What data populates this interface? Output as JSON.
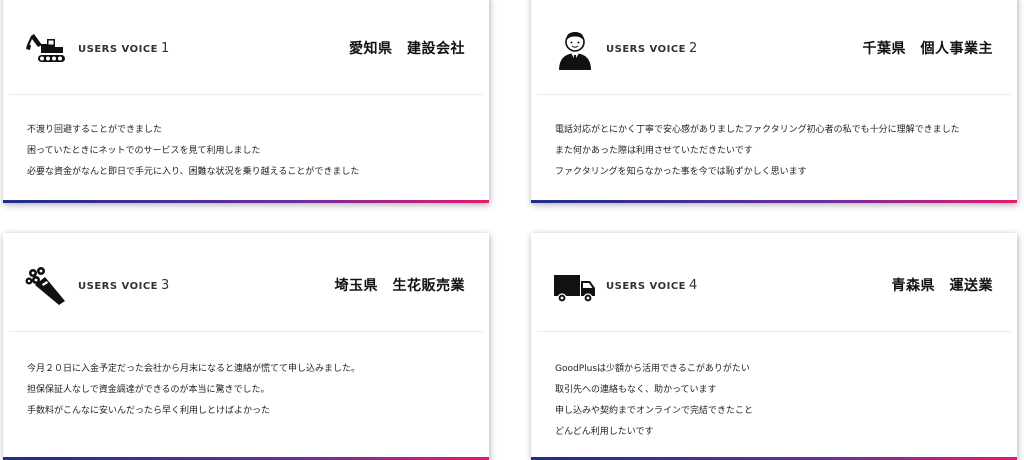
{
  "colors": {
    "gradient_start": "#1d2e8c",
    "gradient_mid": "#6a2f9e",
    "gradient_end": "#e8196f",
    "card_bg": "#ffffff"
  },
  "cards": [
    {
      "icon": "excavator-icon",
      "label": "USERS VOICE",
      "number": "1",
      "region": "愛知県　建設会社",
      "lines": [
        "不渡り回避することができました",
        "困っていたときにネットでのサービスを見て利用しました",
        "必要な資金がなんと即日で手元に入り、困難な状況を乗り越えることができました"
      ]
    },
    {
      "icon": "businessman-icon",
      "label": "USERS VOICE",
      "number": "2",
      "region": "千葉県　個人事業主",
      "lines": [
        "電話対応がとにかく丁寧で安心感がありましたファクタリング初心者の私でも十分に理解できました",
        "また何かあった際は利用させていただきたいです",
        "ファクタリングを知らなかった事を今では恥ずかしく思います"
      ]
    },
    {
      "icon": "flower-bouquet-icon",
      "label": "USERS VOICE",
      "number": "3",
      "region": "埼玉県　生花販売業",
      "lines": [
        "今月２０日に入金予定だった会社から月末になると連絡が慌てて申し込みました。",
        "担保保証人なしで資金調達ができるのが本当に驚きでした。",
        "手数料がこんなに安いんだったら早く利用しとけばよかった"
      ]
    },
    {
      "icon": "truck-icon",
      "label": "USERS VOICE",
      "number": "4",
      "region": "青森県　運送業",
      "lines": [
        "GoodPlusは少額から活用できるこがありがたい",
        "取引先への連絡もなく、助かっています",
        "申し込みや契約までオンラインで完結できたこと",
        "どんどん利用したいです"
      ]
    }
  ]
}
